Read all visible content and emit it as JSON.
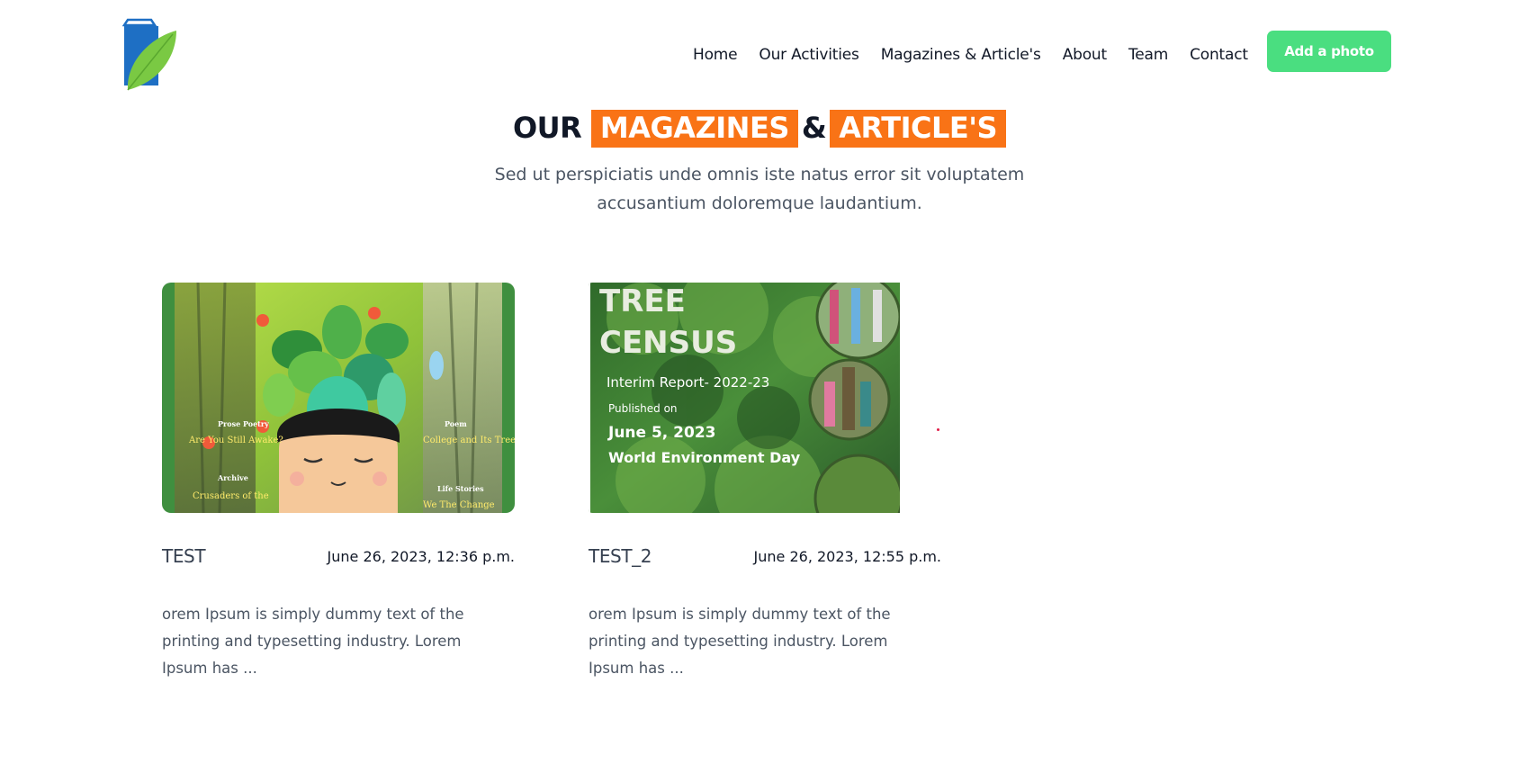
{
  "header": {
    "nav": [
      "Home",
      "Our Activities",
      "Magazines & Article's",
      "About",
      "Team",
      "Contact"
    ],
    "cta_label": "Add a photo"
  },
  "section": {
    "heading_plain_1": "OUR",
    "heading_highlight_1": "MAGAZINES",
    "heading_amp": "&",
    "heading_highlight_2": "ARTICLE'S",
    "subtitle": "Sed ut perspiciatis unde omnis iste natus error sit voluptatem accusantium doloremque laudantium."
  },
  "cards": [
    {
      "title": "TEST",
      "date": "June 26, 2023, 12:36 p.m.",
      "excerpt": "orem Ipsum is simply dummy text of the printing and typesetting industry. Lorem Ipsum has ...",
      "image_text": {
        "l1_tag": "Prose Poetry",
        "l1_text": "Are You Still Awake?",
        "l2_tag": "Archive",
        "l2_text": "Crusaders of the",
        "r1_tag": "Poem",
        "r1_text": "College and Its Trees",
        "r2_tag": "Life Stories",
        "r2_text": "We The Change"
      }
    },
    {
      "title": "TEST_2",
      "date": "June 26, 2023, 12:55 p.m.",
      "excerpt": "orem Ipsum is simply dummy text of the printing and typesetting industry. Lorem Ipsum has ...",
      "image_text": {
        "line1": "TREE",
        "line2": "CENSUS",
        "report": "Interim Report- 2022-23",
        "published": "Published on",
        "date": "June 5, 2023",
        "event": "World Environment Day"
      }
    }
  ],
  "colors": {
    "accent_orange": "#f97316",
    "cta_green": "#4ade80",
    "logo_blue": "#1e6fc4",
    "logo_leaf": "#7ac943"
  }
}
